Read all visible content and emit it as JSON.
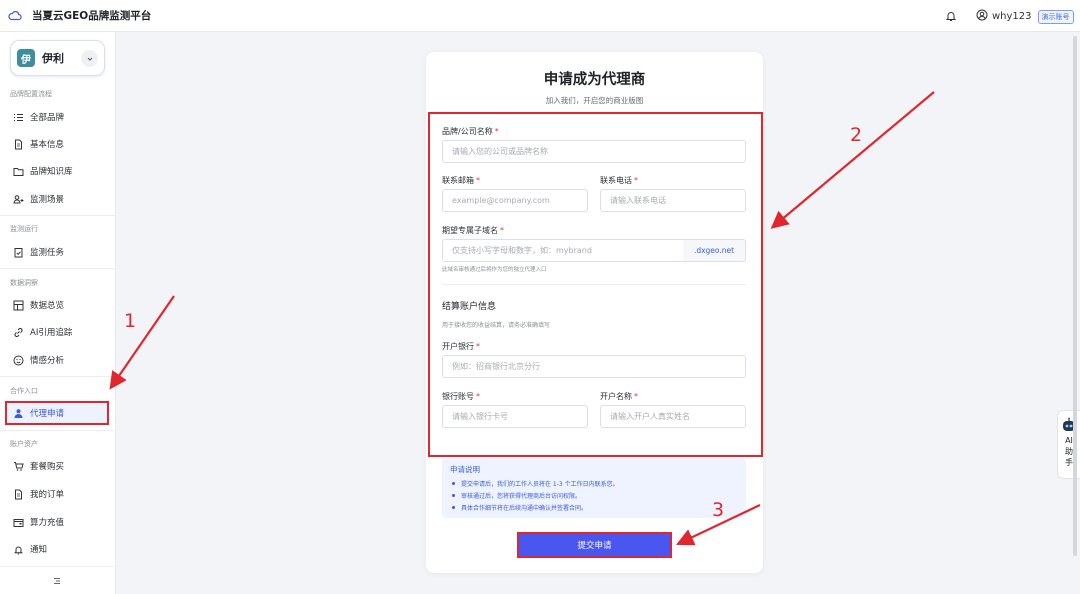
{
  "header": {
    "app_title": "当夏云GEO品牌监测平台",
    "user_name": "why123",
    "demo_badge": "演示账号"
  },
  "brand": {
    "avatar_char": "伊",
    "name": "伊利"
  },
  "sidebar": {
    "sections": [
      {
        "title": "品牌配置流程",
        "items": [
          "全部品牌",
          "基本信息",
          "品牌知识库",
          "监测场景"
        ]
      },
      {
        "title": "监测运行",
        "items": [
          "监测任务"
        ]
      },
      {
        "title": "数据洞察",
        "items": [
          "数据总览",
          "AI引用追踪",
          "情感分析"
        ]
      },
      {
        "title": "合作入口",
        "items": [
          "代理申请"
        ]
      },
      {
        "title": "账户资产",
        "items": [
          "套餐购买",
          "我的订单",
          "算力充值",
          "通知"
        ]
      }
    ],
    "active_item": "代理申请"
  },
  "form": {
    "title": "申请成为代理商",
    "subtitle": "加入我们，开启您的商业版图",
    "company_label": "品牌/公司名称",
    "company_placeholder": "请输入您的公司或品牌名称",
    "email_label": "联系邮箱",
    "email_placeholder": "example@company.com",
    "phone_label": "联系电话",
    "phone_placeholder": "请输入联系电话",
    "domain_label": "期望专属子域名",
    "domain_placeholder": "仅支持小写字母和数字，如：mybrand",
    "domain_suffix": ".dxgeo.net",
    "domain_hint": "此域名审核通过后将作为您的独立代理入口",
    "settlement_title": "结算账户信息",
    "settlement_hint": "用于接收您的收益结算，请务必准确填写",
    "bank_label": "开户银行",
    "bank_placeholder": "例如：招商银行北京分行",
    "account_label": "银行账号",
    "account_placeholder": "请输入银行卡号",
    "holder_label": "开户名称",
    "holder_placeholder": "请输入开户人真实姓名",
    "required_mark": "*"
  },
  "notice": {
    "title": "申请说明",
    "items": [
      "提交申请后，我们的工作人员将在 1-3 个工作日内联系您。",
      "审核通过后，您将获得代理商后台访问权限。",
      "具体合作细节将在后续沟通中确认并签署合同。"
    ]
  },
  "submit_label": "提交申请",
  "annotations": [
    "1",
    "2",
    "3"
  ],
  "ai_helper": {
    "line1": "AI",
    "line2": "助",
    "line3": "手"
  },
  "colors": {
    "accent": "#4a56f0",
    "annotation_red": "#e0262f",
    "active_nav_bg": "#eef2ff",
    "brand_avatar": "#3f8ea0"
  }
}
